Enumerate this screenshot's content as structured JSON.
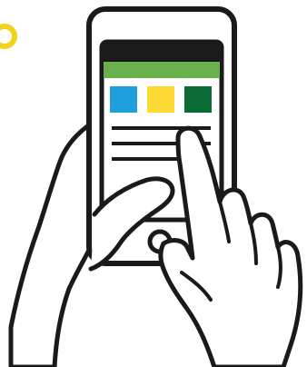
{
  "illustration": {
    "subject": "hands-holding-smartphone",
    "colors": {
      "outline": "#1a1a1a",
      "fill": "#ffffff",
      "accent_ring": "#f2d21b",
      "status_bar": "#1a1a1a",
      "header_bar": "#6ab04c",
      "tile_blue": "#1ea0dc",
      "tile_yellow": "#fcd933",
      "tile_green": "#0b6b35"
    },
    "icons": [
      "ring-icon",
      "home-button-icon"
    ]
  }
}
